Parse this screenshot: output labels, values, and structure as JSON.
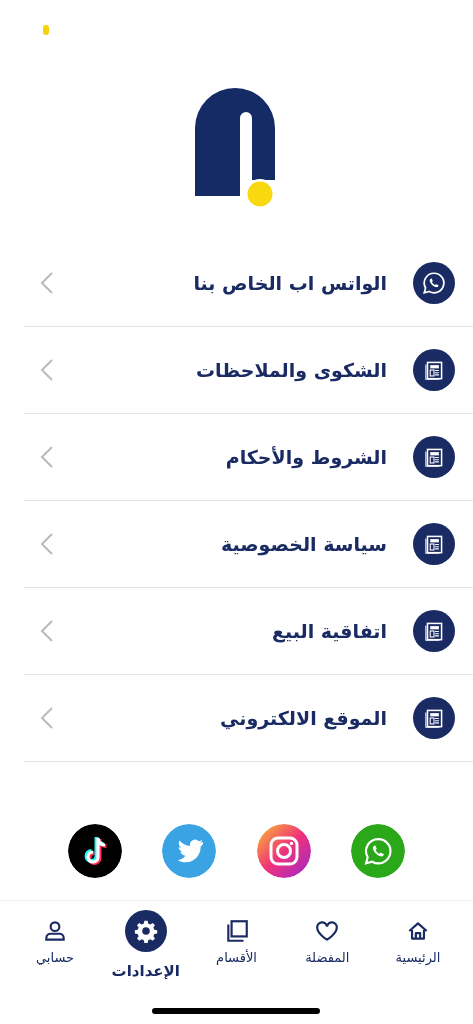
{
  "menu": [
    {
      "label": "الواتس اب الخاص بنا",
      "kind": "whatsapp"
    },
    {
      "label": "الشكوى والملاحظات",
      "kind": "document"
    },
    {
      "label": "الشروط والأحكام",
      "kind": "document"
    },
    {
      "label": "سياسة الخصوصية",
      "kind": "document"
    },
    {
      "label": "اتفاقية البيع",
      "kind": "document"
    },
    {
      "label": "الموقع الالكتروني",
      "kind": "document"
    }
  ],
  "social": [
    {
      "kind": "whatsapp"
    },
    {
      "kind": "instagram"
    },
    {
      "kind": "twitter"
    },
    {
      "kind": "tiktok"
    }
  ],
  "tab_bar": [
    {
      "label": "الرئيسية",
      "kind": "home",
      "selected": false
    },
    {
      "label": "المفضلة",
      "kind": "heart",
      "selected": false
    },
    {
      "label": "الأقسام",
      "kind": "pages",
      "selected": false
    },
    {
      "label": "الإعدادات",
      "kind": "gear",
      "selected": true
    },
    {
      "label": "حسابي",
      "kind": "person",
      "selected": false
    }
  ]
}
